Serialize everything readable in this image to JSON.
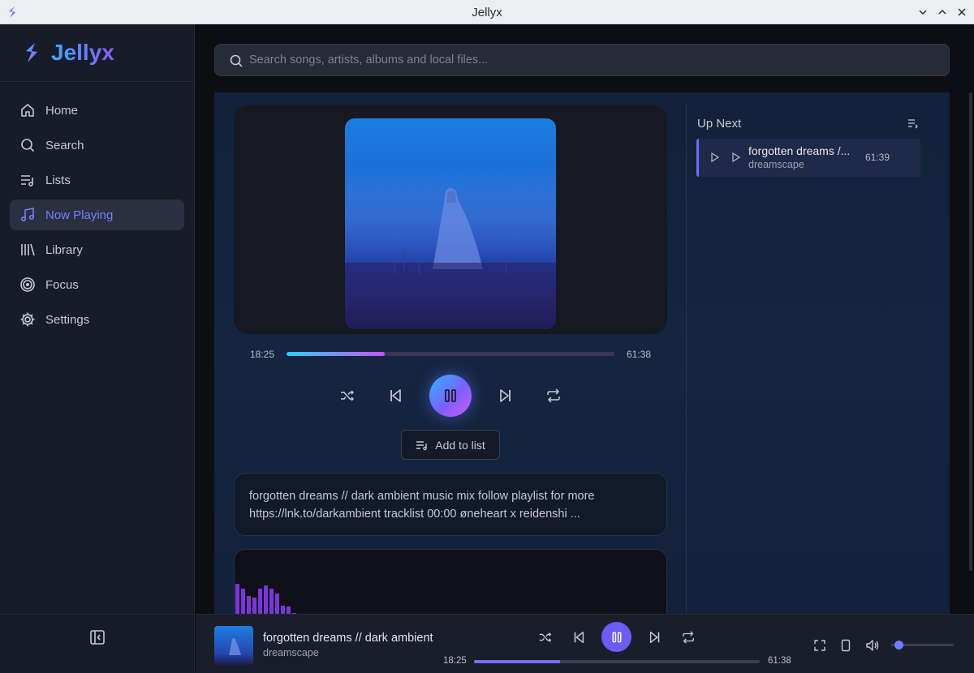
{
  "window": {
    "title": "Jellyx"
  },
  "sidebar": {
    "brand": "Jellyx",
    "items": [
      {
        "label": "Home",
        "icon": "home-icon"
      },
      {
        "label": "Search",
        "icon": "search-icon"
      },
      {
        "label": "Lists",
        "icon": "list-music-icon"
      },
      {
        "label": "Now Playing",
        "icon": "music-note-icon",
        "active": true
      },
      {
        "label": "Library",
        "icon": "library-icon"
      },
      {
        "label": "Focus",
        "icon": "target-icon"
      },
      {
        "label": "Settings",
        "icon": "gear-icon"
      }
    ]
  },
  "search": {
    "placeholder": "Search songs, artists, albums and local files..."
  },
  "now_playing": {
    "elapsed": "18:25",
    "duration": "61:38",
    "progress_fraction": 0.3,
    "add_to_list": "Add to list",
    "description": "forgotten dreams // dark ambient music mix follow playlist for more https://lnk.to/darkambient tracklist 00:00 øneheart x reidenshi ...",
    "visualizer_levels": [
      0.63,
      0.58,
      0.51,
      0.49,
      0.58,
      0.62,
      0.58,
      0.53,
      0.41,
      0.4,
      0.33,
      0.19,
      0.16,
      0.14,
      0.04
    ]
  },
  "up_next": {
    "title": "Up Next",
    "queue": [
      {
        "title": "forgotten dreams /...",
        "artist": "dreamscape",
        "duration": "61:39"
      }
    ]
  },
  "player": {
    "title": "forgotten dreams // dark ambient",
    "artist": "dreamscape",
    "elapsed": "18:25",
    "duration": "61:38",
    "progress_fraction": 0.3,
    "volume_fraction": 0.12
  },
  "colors": {
    "accent": "#6c5cf6",
    "active_nav_text": "#7a7cff",
    "visualizer": "#7a36d9"
  }
}
